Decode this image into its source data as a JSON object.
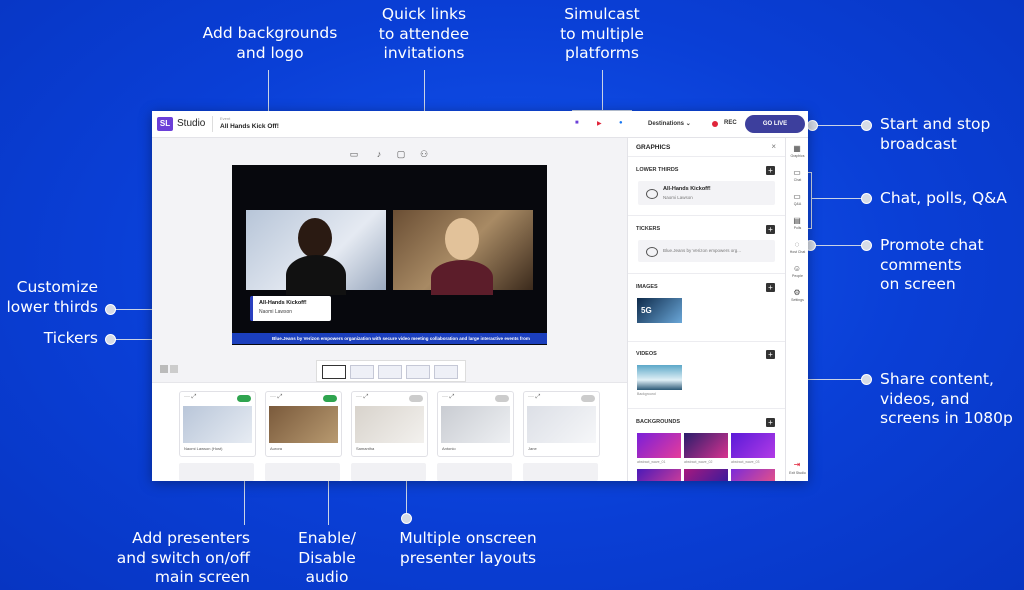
{
  "callouts": {
    "backgrounds": "Add backgrounds\nand logo",
    "quicklinks": "Quick links\nto attendee\ninvitations",
    "simulcast": "Simulcast\nto multiple\nplatforms",
    "start_stop": "Start and stop\nbroadcast",
    "chat": "Chat, polls, Q&A",
    "promote": "Promote chat\ncomments\non screen",
    "share": "Share content,\nvideos, and\nscreens in 1080p",
    "lower_thirds": "Customize\nlower thirds",
    "tickers": "Tickers",
    "presenters": "Add presenters\nand switch on/off\nmain screen",
    "audio": "Enable/\nDisable\naudio",
    "layouts": "Multiple onscreen\npresenter layouts"
  },
  "topbar": {
    "logo": "SL",
    "app_name": "Studio",
    "event_label": "Event",
    "event_title": "All Hands Kick Off!",
    "destinations": "Destinations",
    "rec": "REC",
    "go_live": "GO LIVE"
  },
  "stage": {
    "lower_third_name": "All-Hands Kickoff!",
    "lower_third_sub": "Naomi Lawson",
    "ticker_text": "Blue.Jeans by Verizon empowers organization with secure video meeting collaboration and large interactive events from"
  },
  "presenters": [
    {
      "name": "Naomi Lawson (Host)",
      "on": true
    },
    {
      "name": "Aurora",
      "on": true
    },
    {
      "name": "Samantha",
      "on": false
    },
    {
      "name": "Antonio",
      "on": false
    },
    {
      "name": "Jane",
      "on": false
    }
  ],
  "graphics": {
    "title": "GRAPHICS",
    "lower_thirds": "LOWER THIRDS",
    "lt_item_title": "All-Hands Kickoff!",
    "lt_item_sub": "Naomi Lawson",
    "tickers": "TICKERS",
    "ticker_item": "Blue.Jeans by Verizon empowers org...",
    "images": "IMAGES",
    "image_caption": "5G",
    "videos": "VIDEOS",
    "video_caption": "Background",
    "backgrounds": "BACKGROUNDS",
    "bg_captions": [
      "abstract_wave_01",
      "abstract_wave_02",
      "abstract_wave_03"
    ]
  },
  "rail": {
    "graphics": "Graphics",
    "chat": "Chat",
    "qa": "Q&A",
    "polls": "Polls",
    "hostchat": "Host Chat",
    "people": "People",
    "settings": "Settings",
    "exit": "Exit Studio"
  },
  "colors": {
    "background": "#0a3fd6",
    "go_live": "#3d3f9d",
    "ticker": "#1b3fbd",
    "toggle_on": "#2fa44f"
  }
}
